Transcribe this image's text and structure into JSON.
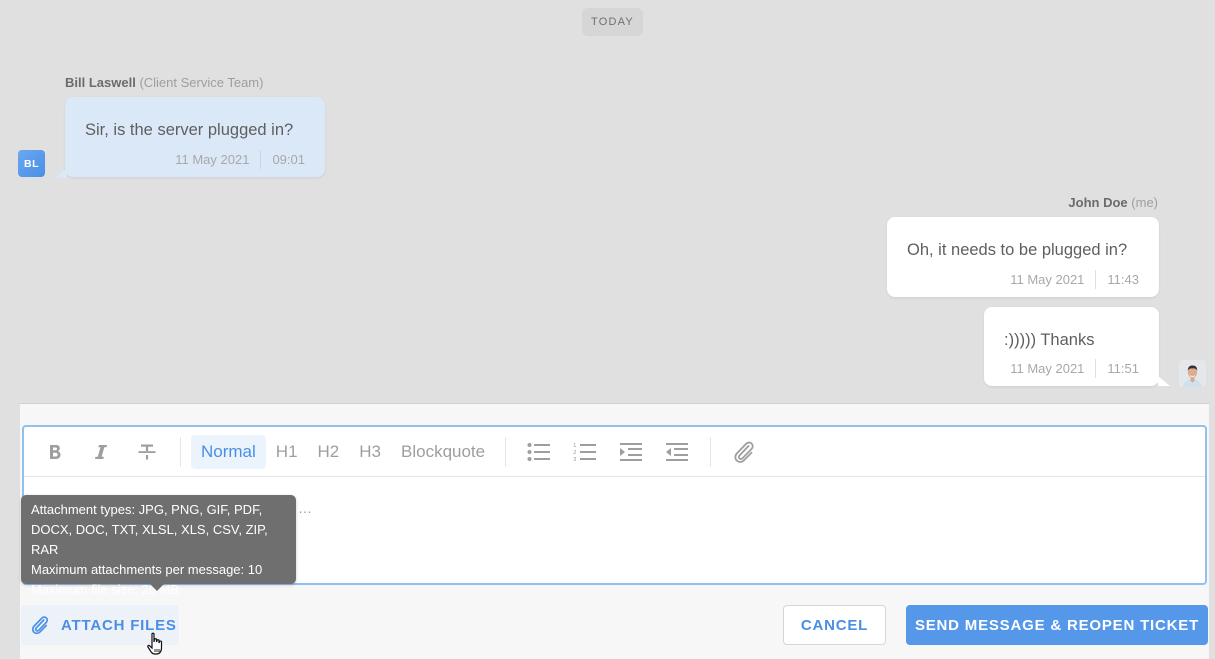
{
  "day_separator": "TODAY",
  "messages": [
    {
      "sender": "Bill Laswell",
      "role": "(Client Service Team)",
      "avatar_initials": "BL",
      "text": "Sir, is the server plugged in?",
      "date": "11 May 2021",
      "time": "09:01",
      "direction": "incoming"
    },
    {
      "sender": "John Doe",
      "role": "(me)",
      "text": "Oh, it needs to be plugged in?",
      "date": "11 May 2021",
      "time": "11:43",
      "direction": "outgoing"
    },
    {
      "text": ":))))) Thanks",
      "date": "11 May 2021",
      "time": "11:51",
      "direction": "outgoing"
    }
  ],
  "toolbar": {
    "format_icons": [
      "bold-icon",
      "italic-icon",
      "strikethrough-icon"
    ],
    "styles": [
      "Normal",
      "H1",
      "H2",
      "H3",
      "Blockquote"
    ],
    "active_style": "Normal",
    "list_icons": [
      "bulleted-list-icon",
      "numbered-list-icon",
      "indent-icon",
      "outdent-icon"
    ],
    "link_icon": "link-icon"
  },
  "editor": {
    "visible_text": "…"
  },
  "tooltip": {
    "lines": [
      "Attachment types: JPG, PNG, GIF, PDF,",
      "DOCX, DOC, TXT, XLSL, XLS, CSV, ZIP, RAR",
      "Maximum attachments per message: 10",
      "Maximum file size: 20 MB"
    ]
  },
  "actions": {
    "attach_label": "ATTACH FILES",
    "cancel_label": "CANCEL",
    "send_label": "SEND MESSAGE & REOPEN TICKET"
  },
  "colors": {
    "accent": "#4a8ee6",
    "incoming_bubble": "#dbe8f8",
    "outgoing_bubble": "#ffffff",
    "tooltip_bg": "#6f6f6f"
  }
}
